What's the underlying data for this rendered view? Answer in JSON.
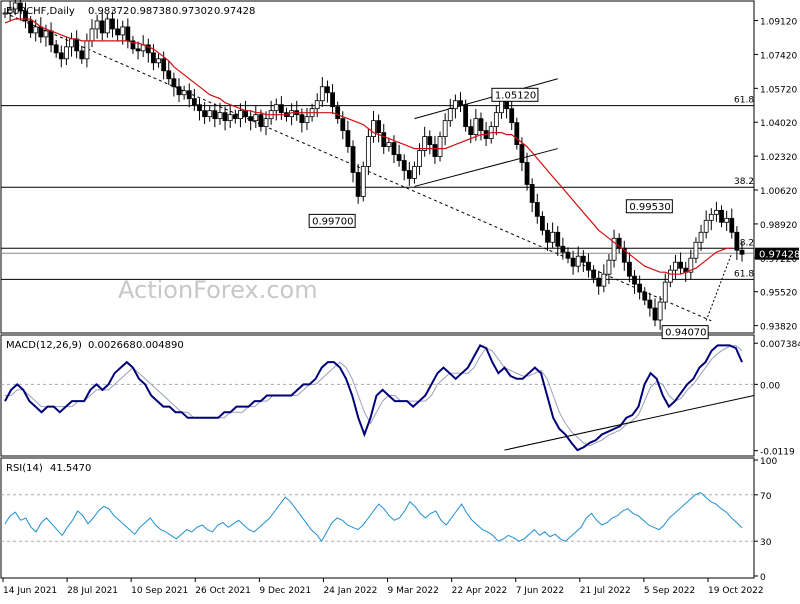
{
  "chart_data": [
    {
      "type": "candlestick",
      "symbol": "EURCHF,Daily",
      "ohlc": {
        "open": "0.98372",
        "high": "0.98738",
        "low": "0.97302",
        "close": "0.97428"
      },
      "watermark": "ActionForex.com",
      "ylim": [
        0.9355,
        1.1
      ],
      "y_ticks": [
        "1.09120",
        "1.07420",
        "1.05720",
        "1.04020",
        "1.02320",
        "1.00620",
        "0.98920",
        "0.97220",
        "0.95520",
        "0.93820"
      ],
      "y_tick_values": [
        1.0912,
        1.0742,
        1.0572,
        1.0402,
        1.0232,
        1.0062,
        0.9892,
        0.9722,
        0.9552,
        0.9382
      ],
      "current_price": {
        "label": "0.97428",
        "value": 0.97428
      },
      "x_dates": [
        "14 Jun 2021",
        "28 Jul 2021",
        "10 Sep 2021",
        "26 Oct 2021",
        "9 Dec 2021",
        "24 Jan 2022",
        "9 Mar 2022",
        "22 Apr 2022",
        "7 Jun 2022",
        "21 Jul 2022",
        "5 Sep 2022",
        "19 Oct 2022"
      ],
      "series": [
        {
          "name": "price",
          "values": [
            1.095,
            1.097,
            1.1,
            1.096,
            1.091,
            1.085,
            1.088,
            1.083,
            1.086,
            1.079,
            1.075,
            1.072,
            1.078,
            1.082,
            1.076,
            1.072,
            1.081,
            1.087,
            1.091,
            1.085,
            1.092,
            1.087,
            1.084,
            1.088,
            1.081,
            1.077,
            1.076,
            1.079,
            1.075,
            1.07,
            1.072,
            1.066,
            1.062,
            1.058,
            1.054,
            1.056,
            1.052,
            1.049,
            1.046,
            1.043,
            1.046,
            1.042,
            1.045,
            1.041,
            1.044,
            1.042,
            1.046,
            1.043,
            1.041,
            1.044,
            1.038,
            1.042,
            1.046,
            1.049,
            1.045,
            1.043,
            1.046,
            1.044,
            1.04,
            1.043,
            1.047,
            1.051,
            1.058,
            1.055,
            1.048,
            1.042,
            1.036,
            1.028,
            1.015,
            1.003,
            1.018,
            1.033,
            1.041,
            1.035,
            1.028,
            1.03,
            1.024,
            1.021,
            1.016,
            1.012,
            1.018,
            1.026,
            1.033,
            1.029,
            1.023,
            1.033,
            1.041,
            1.047,
            1.051,
            1.049,
            1.038,
            1.034,
            1.042,
            1.036,
            1.032,
            1.038,
            1.045,
            1.052,
            1.047,
            1.04,
            1.029,
            1.02,
            1.009,
            1,
            0.993,
            0.986,
            0.98,
            0.985,
            0.978,
            0.975,
            0.972,
            0.968,
            0.973,
            0.97,
            0.966,
            0.962,
            0.958,
            0.964,
            0.971,
            0.982,
            0.977,
            0.97,
            0.963,
            0.959,
            0.955,
            0.951,
            0.947,
            0.941,
            0.95,
            0.96,
            0.966,
            0.97,
            0.967,
            0.965,
            0.972,
            0.98,
            0.985,
            0.991,
            0.994,
            0.996,
            0.99,
            0.992,
            0.985,
            0.976,
            0.974
          ]
        },
        {
          "name": "MA",
          "values": [
            1.09,
            1.091,
            1.092,
            1.092,
            1.092,
            1.092,
            1.09,
            1.088,
            1.087,
            1.086,
            1.085,
            1.084,
            1.083,
            1.082,
            1.082,
            1.081,
            1.081,
            1.081,
            1.081,
            1.081,
            1.081,
            1.081,
            1.081,
            1.081,
            1.081,
            1.08,
            1.08,
            1.079,
            1.078,
            1.077,
            1.075,
            1.073,
            1.071,
            1.068,
            1.066,
            1.064,
            1.062,
            1.06,
            1.058,
            1.056,
            1.054,
            1.053,
            1.052,
            1.05,
            1.049,
            1.048,
            1.047,
            1.046,
            1.046,
            1.045,
            1.045,
            1.044,
            1.044,
            1.044,
            1.044,
            1.044,
            1.045,
            1.045,
            1.045,
            1.045,
            1.045,
            1.045,
            1.045,
            1.045,
            1.045,
            1.044,
            1.043,
            1.042,
            1.041,
            1.04,
            1.039,
            1.037,
            1.035,
            1.034,
            1.033,
            1.032,
            1.031,
            1.03,
            1.029,
            1.028,
            1.027,
            1.027,
            1.027,
            1.027,
            1.027,
            1.027,
            1.027,
            1.028,
            1.029,
            1.03,
            1.031,
            1.032,
            1.033,
            1.034,
            1.034,
            1.035,
            1.035,
            1.035,
            1.034,
            1.034,
            1.032,
            1.03,
            1.028,
            1.025,
            1.022,
            1.019,
            1.016,
            1.013,
            1.01,
            1.007,
            1.004,
            1.001,
            0.998,
            0.995,
            0.992,
            0.989,
            0.986,
            0.984,
            0.982,
            0.98,
            0.978,
            0.976,
            0.974,
            0.972,
            0.97,
            0.968,
            0.967,
            0.966,
            0.965,
            0.965,
            0.964,
            0.964,
            0.964,
            0.965,
            0.966,
            0.967,
            0.969,
            0.971,
            0.973,
            0.975,
            0.976,
            0.977,
            0.977
          ]
        }
      ],
      "horizontal_levels": [
        {
          "label": "61.8",
          "value": 1.0485
        },
        {
          "label": "38.2",
          "value": 1.0076
        },
        {
          "label": "38.2",
          "value": 0.977
        },
        {
          "label": "61.8",
          "value": 0.9614
        }
      ],
      "horizontal_line": {
        "value": 0.9745
      },
      "trendline": {
        "from": [
          0,
          1.095
        ],
        "to": [
          138,
          0.9406
        ]
      },
      "channel": {
        "lower": {
          "from": [
            80,
            1.008
          ],
          "to": [
            108,
            1.027
          ]
        },
        "upper": {
          "from": [
            80,
            1.042
          ],
          "to": [
            108,
            1.062
          ]
        }
      },
      "fib_up": {
        "from": [
          137,
          0.9407
        ],
        "to": [
          142,
          0.9745
        ]
      },
      "annotations": [
        {
          "label": "1.05120",
          "value": 1.0512
        },
        {
          "label": "0.99700",
          "value": 0.997
        },
        {
          "label": "0.99530",
          "value": 0.9953
        },
        {
          "label": "0.94070",
          "value": 0.9407
        }
      ]
    },
    {
      "type": "line",
      "label": "MACD(12,26,9)",
      "params": [
        "0.002668",
        "0.004890"
      ],
      "ylim": [
        -0.0125,
        0.0085
      ],
      "y_ticks": [
        "0.007384",
        "0.00",
        "-0.0119"
      ],
      "y_tick_values": [
        0.007384,
        0.0,
        -0.0119
      ],
      "series": [
        {
          "name": "MACD",
          "values": [
            -0.003,
            -0.001,
            0,
            -0.001,
            -0.003,
            -0.004,
            -0.005,
            -0.004,
            -0.004,
            -0.005,
            -0.004,
            -0.003,
            -0.003,
            -0.003,
            -0.001,
            0,
            -0.001,
            0,
            0.002,
            0.003,
            0.004,
            0.003,
            0.001,
            0,
            -0.002,
            -0.003,
            -0.004,
            -0.004,
            -0.005,
            -0.005,
            -0.006,
            -0.006,
            -0.006,
            -0.006,
            -0.006,
            -0.006,
            -0.005,
            -0.005,
            -0.004,
            -0.004,
            -0.004,
            -0.003,
            -0.003,
            -0.002,
            -0.002,
            -0.002,
            -0.002,
            -0.002,
            -0.001,
            0,
            0,
            0.001,
            0.003,
            0.004,
            0.004,
            0.003,
            0.001,
            -0.002,
            -0.006,
            -0.009,
            -0.006,
            -0.002,
            -0.001,
            -0.002,
            -0.003,
            -0.003,
            -0.003,
            -0.004,
            -0.003,
            -0.002,
            0,
            0.002,
            0.003,
            0.002,
            0.001,
            0.002,
            0.003,
            0.005,
            0.007,
            0.0065,
            0.004,
            0.002,
            0.003,
            0.0015,
            0.001,
            0.001,
            0.002,
            0.003,
            0.002,
            -0.002,
            -0.006,
            -0.008,
            -0.009,
            -0.0105,
            -0.0118,
            -0.0113,
            -0.0105,
            -0.01,
            -0.009,
            -0.0085,
            -0.008,
            -0.0075,
            -0.006,
            -0.0055,
            -0.004,
            0,
            0.002,
            0.001,
            -0.002,
            -0.004,
            -0.003,
            -0.0015,
            0,
            0.001,
            0.003,
            0.004,
            0.006,
            0.007,
            0.007,
            0.007,
            0.0065,
            0.004
          ]
        },
        {
          "name": "Signal",
          "values": [
            -0.002,
            -0.002,
            -0.001,
            -0.001,
            -0.002,
            -0.003,
            -0.004,
            -0.004,
            -0.004,
            -0.004,
            -0.004,
            -0.004,
            -0.003,
            -0.003,
            -0.002,
            -0.001,
            -0.001,
            -0.001,
            0,
            0.001,
            0.002,
            0.003,
            0.002,
            0.001,
            0,
            -0.001,
            -0.002,
            -0.003,
            -0.004,
            -0.005,
            -0.005,
            -0.006,
            -0.006,
            -0.006,
            -0.006,
            -0.006,
            -0.006,
            -0.005,
            -0.005,
            -0.005,
            -0.004,
            -0.004,
            -0.003,
            -0.003,
            -0.002,
            -0.002,
            -0.002,
            -0.002,
            -0.002,
            -0.001,
            0,
            0,
            0.001,
            0.002,
            0.003,
            0.004,
            0.003,
            0.001,
            -0.002,
            -0.005,
            -0.007,
            -0.005,
            -0.003,
            -0.002,
            -0.002,
            -0.003,
            -0.003,
            -0.003,
            -0.003,
            -0.003,
            -0.002,
            0,
            0.001,
            0.002,
            0.002,
            0.002,
            0.002,
            0.003,
            0.005,
            0.0065,
            0.006,
            0.0045,
            0.003,
            0.0025,
            0.002,
            0.0015,
            0.0015,
            0.002,
            0.0025,
            0.001,
            -0.002,
            -0.005,
            -0.007,
            -0.0085,
            -0.0095,
            -0.0105,
            -0.011,
            -0.0105,
            -0.01,
            -0.0092,
            -0.0087,
            -0.0082,
            -0.0072,
            -0.0065,
            -0.0055,
            -0.003,
            -0.0005,
            0.0005,
            0,
            -0.002,
            -0.003,
            -0.0025,
            -0.001,
            0,
            0.0015,
            0.003,
            0.0045,
            0.0055,
            0.0063,
            0.0068,
            0.007,
            0.006
          ]
        }
      ],
      "trendline": {
        "from": [
          82,
          -0.0118
        ],
        "to": [
          123,
          -0.002
        ]
      }
    },
    {
      "type": "line",
      "label": "RSI(14)",
      "value": "41.5470",
      "ylim": [
        0,
        100
      ],
      "y_ticks": [
        "100",
        "70",
        "30",
        "0"
      ],
      "y_tick_values": [
        100,
        70,
        30,
        0
      ],
      "levels": [
        70,
        30
      ],
      "series": [
        {
          "name": "RSI",
          "values": [
            45,
            52,
            55,
            48,
            50,
            42,
            38,
            46,
            50,
            45,
            40,
            35,
            42,
            48,
            56,
            52,
            45,
            50,
            56,
            60,
            58,
            52,
            48,
            44,
            40,
            36,
            42,
            46,
            50,
            44,
            40,
            38,
            35,
            32,
            36,
            40,
            38,
            42,
            44,
            40,
            38,
            44,
            46,
            42,
            45,
            48,
            44,
            40,
            38,
            42,
            46,
            50,
            56,
            62,
            68,
            64,
            58,
            52,
            46,
            40,
            36,
            30,
            38,
            46,
            50,
            48,
            44,
            42,
            40,
            44,
            50,
            56,
            62,
            58,
            52,
            48,
            50,
            56,
            64,
            60,
            54,
            50,
            54,
            56,
            48,
            44,
            50,
            56,
            62,
            54,
            48,
            44,
            40,
            38,
            35,
            30,
            32,
            35,
            33,
            30,
            32,
            36,
            40,
            35,
            38,
            34,
            36,
            32,
            30,
            34,
            38,
            42,
            50,
            54,
            48,
            44,
            46,
            50,
            52,
            56,
            58,
            54,
            52,
            48,
            44,
            42,
            40,
            44,
            50,
            54,
            58,
            62,
            66,
            70,
            72,
            68,
            64,
            62,
            58,
            55,
            50,
            46,
            41.5
          ]
        }
      ]
    }
  ]
}
